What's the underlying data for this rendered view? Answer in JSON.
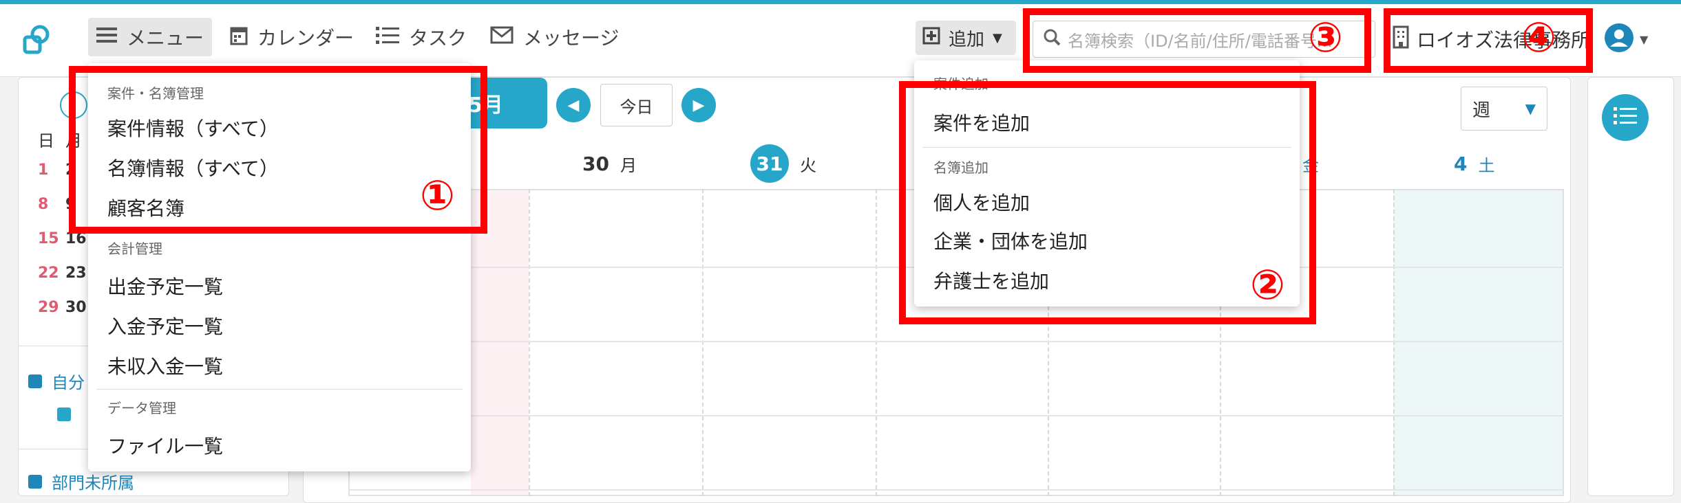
{
  "app": {
    "nav": {
      "menu": "メニュー",
      "calendar": "カレンダー",
      "task": "タスク",
      "message": "メッセージ"
    },
    "add_button": "追加",
    "search_placeholder": "名簿検索（ID/名前/住所/電話番号...",
    "org_name": "ロイオズ法律事務所"
  },
  "menu_dropdown": {
    "section1": "案件・名簿管理",
    "items1": [
      "案件情報（すべて）",
      "名簿情報（すべて）",
      "顧客名簿"
    ],
    "section2": "会計管理",
    "items2": [
      "出金予定一覧",
      "入金予定一覧",
      "未収入金一覧"
    ],
    "section3": "データ管理",
    "items3": [
      "ファイル一覧"
    ]
  },
  "add_dropdown": {
    "section1": "案件追加",
    "items1": [
      "案件を追加"
    ],
    "section2": "名簿追加",
    "items2": [
      "個人を追加",
      "企業・団体を追加",
      "弁護士を追加"
    ]
  },
  "calendar": {
    "month_label": "5月",
    "today": "今日",
    "view": "週",
    "days": [
      {
        "num": "30",
        "dow": "月"
      },
      {
        "num": "31",
        "dow": "火"
      },
      {
        "num": "4",
        "dow": "土"
      }
    ],
    "friday_dow": "金",
    "mini_cal_head": [
      "日",
      "月"
    ],
    "mini_cal_rows": [
      [
        "1",
        "2"
      ],
      [
        "8",
        "9"
      ],
      [
        "15",
        "16"
      ],
      [
        "22",
        "23"
      ],
      [
        "29",
        "30"
      ]
    ],
    "self_label": "自分",
    "dept_label": "部門未所属"
  },
  "annotations": [
    "①",
    "②",
    "③",
    "④"
  ],
  "colors": {
    "accent": "#26a7c9",
    "annotation": "#ff0000"
  }
}
